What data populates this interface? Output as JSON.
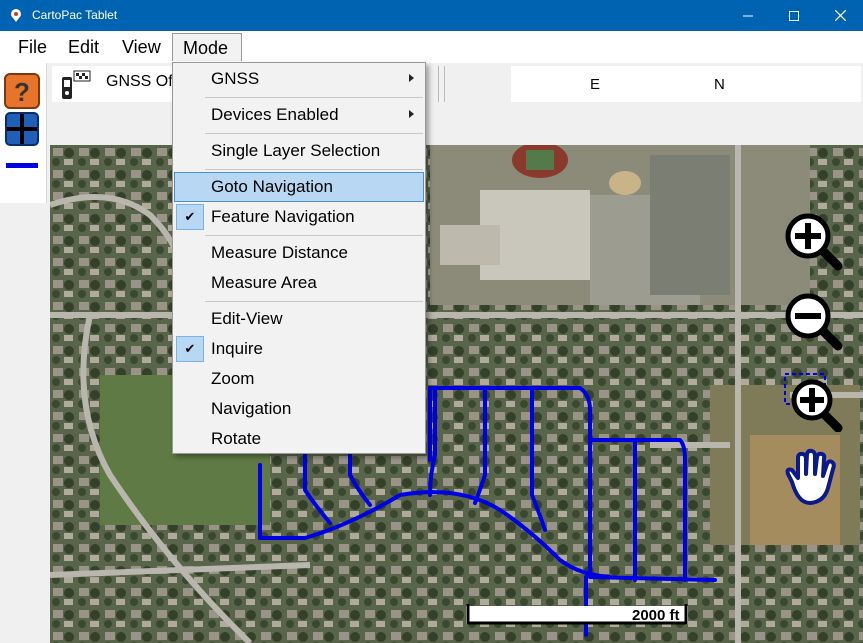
{
  "window": {
    "title": "CartoPac Tablet"
  },
  "menubar": {
    "file": "File",
    "edit": "Edit",
    "view": "View",
    "mode": "Mode"
  },
  "toolbar": {
    "gnss_status": "GNSS Off",
    "coord_e_label": "E",
    "coord_n_label": "N"
  },
  "mode_menu": {
    "items": [
      {
        "label": "GNSS",
        "submenu": true
      },
      {
        "label": "Devices Enabled",
        "submenu": true
      },
      {
        "label": "Single Layer Selection"
      },
      {
        "label": "Goto Navigation",
        "highlighted": true
      },
      {
        "label": "Feature Navigation",
        "checked": true
      },
      {
        "label": "Measure Distance"
      },
      {
        "label": "Measure Area"
      },
      {
        "label": "Edit-View"
      },
      {
        "label": "Inquire",
        "checked": true
      },
      {
        "label": "Zoom"
      },
      {
        "label": "Navigation"
      },
      {
        "label": "Rotate"
      }
    ]
  },
  "map": {
    "scale_label": "2000 ft",
    "road_color": "#0000e6"
  },
  "icons": [
    "help-icon",
    "crosshair-icon",
    "zoom-in-icon",
    "zoom-out-icon",
    "zoom-box-icon",
    "pan-hand-icon",
    "submenu-arrow-icon",
    "checkmark-icon"
  ]
}
